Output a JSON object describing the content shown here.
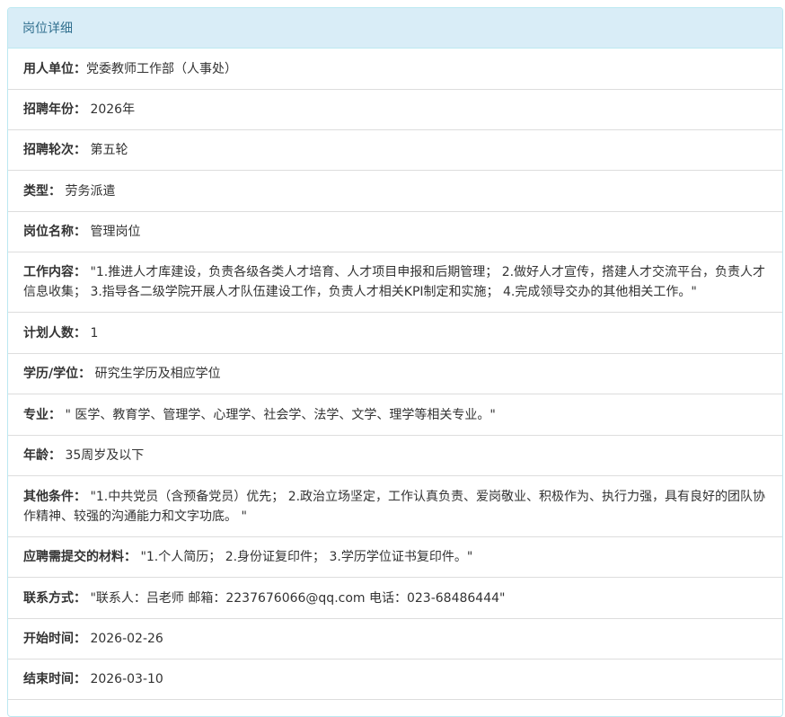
{
  "panel": {
    "title": "岗位详细"
  },
  "fields": [
    {
      "label": "用人单位：",
      "value": "党委教师工作部（人事处）"
    },
    {
      "label": "招聘年份：",
      "value": "2026年"
    },
    {
      "label": "招聘轮次：",
      "value": "第五轮"
    },
    {
      "label": "类型：",
      "value": "劳务派遣"
    },
    {
      "label": "岗位名称：",
      "value": "管理岗位"
    },
    {
      "label": "工作内容：",
      "value": "\"1.推进人才库建设，负责各级各类人才培育、人才项目申报和后期管理； 2.做好人才宣传，搭建人才交流平台，负责人才信息收集； 3.指导各二级学院开展人才队伍建设工作，负责人才相关KPI制定和实施； 4.完成领导交办的其他相关工作。\""
    },
    {
      "label": "计划人数：",
      "value": "1"
    },
    {
      "label": "学历/学位：",
      "value": "研究生学历及相应学位"
    },
    {
      "label": "专业：",
      "value": "\" 医学、教育学、管理学、心理学、社会学、法学、文学、理学等相关专业。\""
    },
    {
      "label": "年龄：",
      "value": "35周岁及以下"
    },
    {
      "label": "其他条件：",
      "value": "\"1.中共党员（含预备党员）优先； 2.政治立场坚定，工作认真负责、爱岗敬业、积极作为、执行力强，具有良好的团队协作精神、较强的沟通能力和文字功底。 \""
    },
    {
      "label": "应聘需提交的材料：",
      "value": "\"1.个人简历； 2.身份证复印件； 3.学历学位证书复印件。\""
    },
    {
      "label": "联系方式：",
      "value": "\"联系人：吕老师 邮箱：2237676066@qq.com 电话：023-68486444\""
    },
    {
      "label": "开始时间：",
      "value": "2026-02-26"
    },
    {
      "label": "结束时间：",
      "value": "2026-03-10"
    }
  ]
}
